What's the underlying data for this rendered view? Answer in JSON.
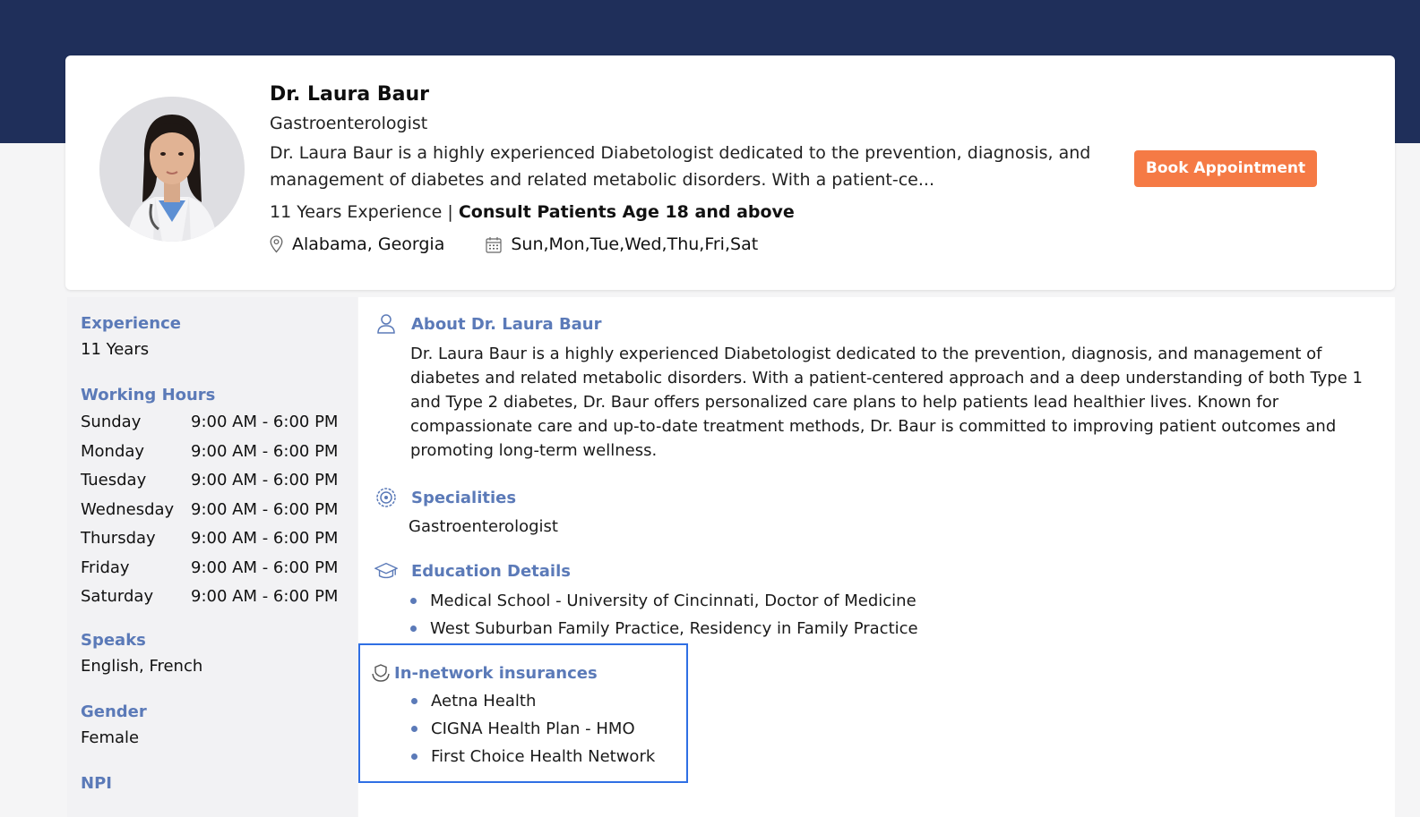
{
  "doctor": {
    "name": "Dr. Laura Baur",
    "title": "Gastroenterologist",
    "summary": "Dr. Laura Baur is a highly experienced Diabetologist dedicated to the prevention, diagnosis, and management of diabetes and related metabolic disorders. With a patient-ce...",
    "experience_text": "11 Years Experience | ",
    "consult_text": "Consult Patients Age 18 and above",
    "location": "Alabama, Georgia",
    "days": "Sun,Mon,Tue,Wed,Thu,Fri,Sat",
    "book_label": "Book Appointment"
  },
  "sidebar": {
    "experience_label": "Experience",
    "experience_value": "11 Years",
    "working_hours_label": "Working Hours",
    "hours": [
      {
        "day": "Sunday",
        "time": "9:00 AM - 6:00 PM"
      },
      {
        "day": "Monday",
        "time": "9:00 AM - 6:00 PM"
      },
      {
        "day": "Tuesday",
        "time": "9:00 AM - 6:00 PM"
      },
      {
        "day": "Wednesday",
        "time": "9:00 AM - 6:00 PM"
      },
      {
        "day": "Thursday",
        "time": "9:00 AM - 6:00 PM"
      },
      {
        "day": "Friday",
        "time": "9:00 AM - 6:00 PM"
      },
      {
        "day": "Saturday",
        "time": "9:00 AM - 6:00 PM"
      }
    ],
    "speaks_label": "Speaks",
    "speaks_value": "English, French",
    "gender_label": "Gender",
    "gender_value": "Female",
    "npi_label": "NPI"
  },
  "main": {
    "about_title": "About Dr. Laura Baur",
    "about_text": "Dr. Laura Baur is a highly experienced Diabetologist dedicated to the prevention, diagnosis, and management of diabetes and related metabolic disorders. With a patient-centered approach and a deep understanding of both Type 1 and Type 2 diabetes, Dr. Baur offers personalized care plans to help patients lead healthier lives. Known for compassionate care and up-to-date treatment methods, Dr. Baur is committed to improving patient outcomes and promoting long-term wellness.",
    "specialities_title": "Specialities",
    "specialities_value": "Gastroenterologist",
    "education_title": "Education Details",
    "education": [
      "Medical School - University of Cincinnati, Doctor of Medicine",
      "West Suburban Family Practice, Residency in Family Practice"
    ],
    "insurance_title": "In-network insurances",
    "insurances": [
      "Aetna Health",
      "CIGNA Health Plan - HMO",
      "First Choice Health Network"
    ]
  },
  "colors": {
    "header_band": "#1f2f5a",
    "accent_blue": "#5b7ab8",
    "button_orange": "#f57a45",
    "highlight_border": "#2f6fe4"
  },
  "icons": [
    "location-pin-icon",
    "calendar-icon",
    "user-icon",
    "speciality-badge-icon",
    "graduation-cap-icon",
    "insurance-hand-icon"
  ]
}
